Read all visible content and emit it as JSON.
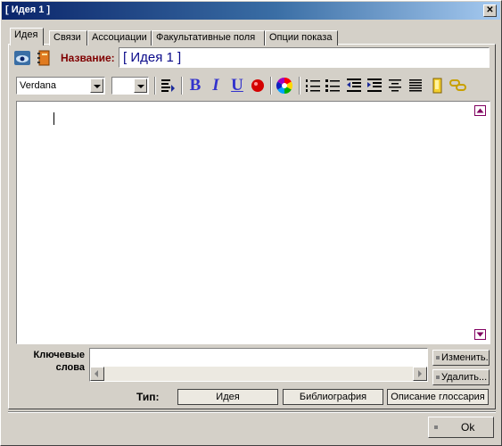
{
  "window": {
    "title": "[ Идея 1 ]",
    "close_glyph": "✕"
  },
  "tabs": [
    {
      "label": "Идея",
      "active": true
    },
    {
      "label": "Связи"
    },
    {
      "label": "Ассоциации"
    },
    {
      "label": "Факультативные поля"
    },
    {
      "label": "Опции показа"
    }
  ],
  "name_row": {
    "label": "Название:",
    "value": "[ Идея 1 ]"
  },
  "toolbar": {
    "font_family": "Verdana",
    "font_size": "",
    "bold": "B",
    "italic": "I",
    "underline": "U",
    "icons": [
      "tab-stop-icon",
      "red-ball-icon",
      "color-wheel-icon",
      "numbered-list-icon",
      "bullet-list-icon",
      "outdent-icon",
      "indent-icon",
      "align-center-icon",
      "align-justify-icon",
      "insert-page-icon",
      "chain-link-icon"
    ]
  },
  "editor": {
    "content": ""
  },
  "keywords": {
    "label": "Ключевые слова",
    "value": "",
    "edit_button": "Изменить...",
    "delete_button": "Удалить..."
  },
  "type_row": {
    "label": "Тип:",
    "options": [
      "Идея",
      "Библиография",
      "Описание глоссария"
    ]
  },
  "footer": {
    "ok_button": "Ok"
  },
  "colors": {
    "title_start": "#0a246a",
    "title_end": "#a6caf0",
    "name_label": "#800000",
    "accent": "#3333cc",
    "marker": "#800060"
  }
}
